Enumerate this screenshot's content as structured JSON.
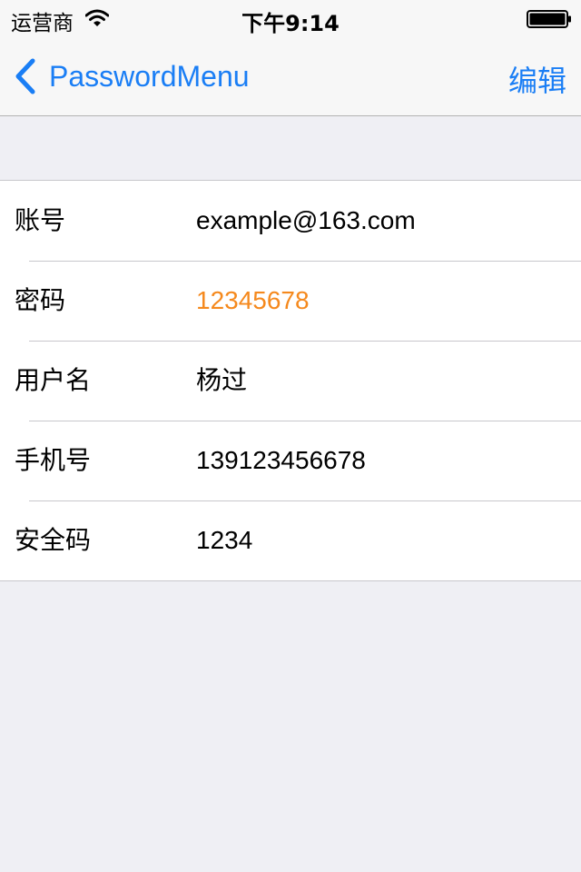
{
  "status_bar": {
    "carrier": "运营商",
    "time": "下午9:14",
    "wifi_icon": "wifi-icon",
    "battery_icon": "battery-icon"
  },
  "nav": {
    "back_label": "PasswordMenu",
    "back_icon": "chevron-left-icon",
    "edit_label": "编辑",
    "accent_color": "#1a7ef5"
  },
  "details": {
    "rows": [
      {
        "label": "账号",
        "value": "example@163.com"
      },
      {
        "label": "密码",
        "value": "12345678",
        "value_color": "#f5891d"
      },
      {
        "label": "用户名",
        "value": "杨过"
      },
      {
        "label": "手机号",
        "value": "139123456678"
      },
      {
        "label": "安全码",
        "value": "1234"
      }
    ]
  }
}
